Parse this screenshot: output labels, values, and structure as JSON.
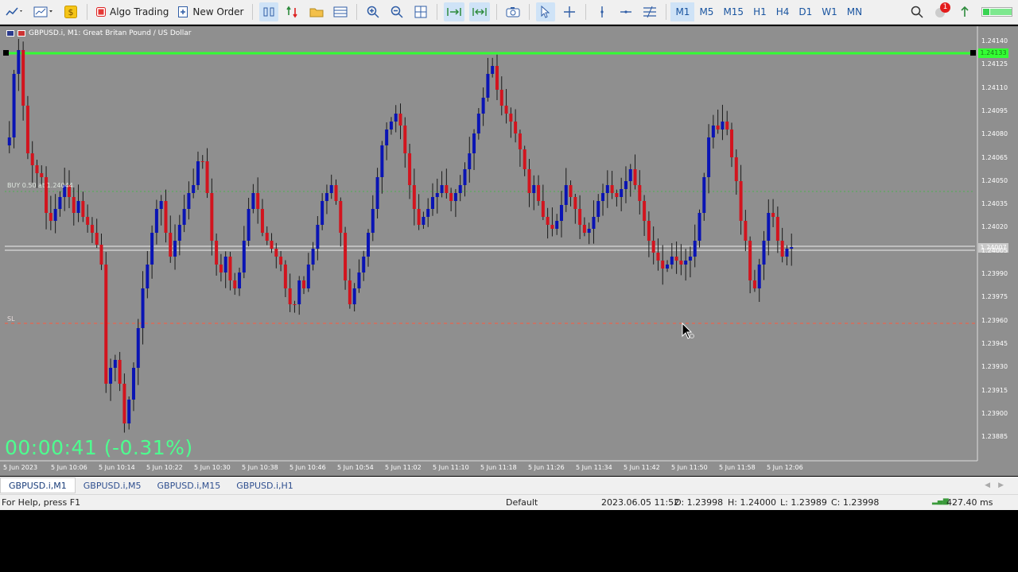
{
  "toolbar": {
    "algo_trading_label": "Algo Trading",
    "new_order_label": "New Order",
    "timeframes": [
      "M1",
      "M5",
      "M15",
      "H1",
      "H4",
      "D1",
      "W1",
      "MN"
    ],
    "active_timeframe": "M1",
    "notification_count": "1"
  },
  "chart": {
    "header_text": "GBPUSD.i, M1:  Great Britan Pound / US Dollar",
    "buy_label": "BUY 0.50 at 1.24044",
    "sl_label": "SL",
    "timer": "00:00:41 (-0.31%)",
    "tp_price_tag": "1.24133",
    "bid_price_tag": "1.24007",
    "price_ticks": [
      "1.24140",
      "1.24125",
      "1.24110",
      "1.24095",
      "1.24080",
      "1.24065",
      "1.24050",
      "1.24035",
      "1.24020",
      "1.24005",
      "1.23990",
      "1.23975",
      "1.23960",
      "1.23945",
      "1.23930",
      "1.23915",
      "1.23900",
      "1.23885"
    ],
    "time_ticks": [
      "5 Jun 2023",
      "5 Jun 10:06",
      "5 Jun 10:14",
      "5 Jun 10:22",
      "5 Jun 10:30",
      "5 Jun 10:38",
      "5 Jun 10:46",
      "5 Jun 10:54",
      "5 Jun 11:02",
      "5 Jun 11:10",
      "5 Jun 11:18",
      "5 Jun 11:26",
      "5 Jun 11:34",
      "5 Jun 11:42",
      "5 Jun 11:50",
      "5 Jun 11:58",
      "5 Jun 12:06"
    ],
    "colors": {
      "background": "#8f8f8f",
      "bull": "#0a14b4",
      "bear": "#d2141e",
      "tp_line": "#33ff33",
      "buy_line": "#4caf50",
      "sl_line": "#ff5a3c",
      "timer": "#4dff8f"
    }
  },
  "tabs": [
    "GBPUSD.i,M1",
    "GBPUSD.i,M5",
    "GBPUSD.i,M15",
    "GBPUSD.i,H1"
  ],
  "active_tab": "GBPUSD.i,M1",
  "status": {
    "help": "For Help, press F1",
    "profile": "Default",
    "datetime": "2023.06.05 11:52",
    "open": "O: 1.23998",
    "high": "H: 1.24000",
    "low": "L: 1.23989",
    "close": "C: 1.23998",
    "ping": "427.40 ms"
  }
}
